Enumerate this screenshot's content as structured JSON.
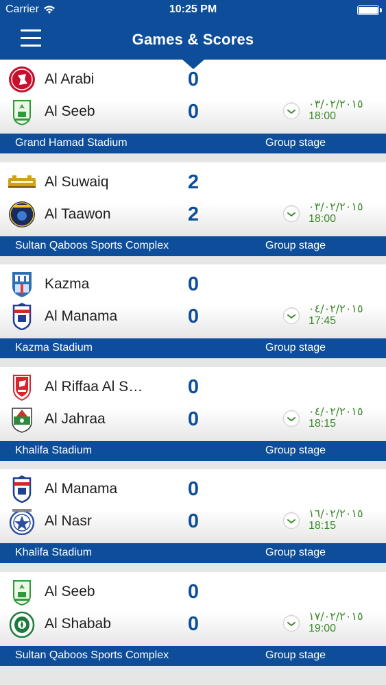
{
  "status": {
    "carrier": "Carrier",
    "time": "10:25 PM"
  },
  "nav": {
    "title": "Games & Scores"
  },
  "matches": [
    {
      "home": {
        "name": "Al Arabi",
        "score": "0",
        "logo": "al-arabi-logo",
        "color": "#c8102e"
      },
      "away": {
        "name": "Al Seeb",
        "score": "0",
        "logo": "al-seeb-logo",
        "color": "#2e9a3c"
      },
      "date": "٠٣/٠٢/٢٠١٥",
      "time": "18:00",
      "stadium": "Grand Hamad Stadium",
      "stage": "Group stage"
    },
    {
      "home": {
        "name": "Al Suwaiq",
        "score": "2",
        "logo": "al-suwaiq-logo",
        "color": "#d4a017"
      },
      "away": {
        "name": "Al Taawon",
        "score": "2",
        "logo": "al-taawon-logo",
        "color": "#1a2a5a"
      },
      "date": "٠٣/٠٢/٢٠١٥",
      "time": "18:00",
      "stadium": "Sultan Qaboos Sports Complex",
      "stage": "Group stage"
    },
    {
      "home": {
        "name": "Kazma",
        "score": "0",
        "logo": "kazma-logo",
        "color": "#2f6fb5"
      },
      "away": {
        "name": "Al Manama",
        "score": "0",
        "logo": "al-manama-logo",
        "color": "#1f3f8f"
      },
      "date": "٠٤/٠٢/٢٠١٥",
      "time": "17:45",
      "stadium": "Kazma Stadium",
      "stage": "Group stage"
    },
    {
      "home": {
        "name": "Al Riffaa Al Shamali",
        "score": "0",
        "logo": "al-riffaa-logo",
        "color": "#d7262b"
      },
      "away": {
        "name": "Al Jahraa",
        "score": "0",
        "logo": "al-jahraa-logo",
        "color": "#c0392b"
      },
      "date": "٠٤/٠٢/٢٠١٥",
      "time": "18:15",
      "stadium": "Khalifa Stadium",
      "stage": "Group stage"
    },
    {
      "home": {
        "name": "Al Manama",
        "score": "0",
        "logo": "al-manama-logo",
        "color": "#1f3f8f"
      },
      "away": {
        "name": "Al Nasr",
        "score": "0",
        "logo": "al-nasr-logo",
        "color": "#2c4f9e"
      },
      "date": "١٦/٠٢/٢٠١٥",
      "time": "18:15",
      "stadium": "Khalifa Stadium",
      "stage": "Group stage"
    },
    {
      "home": {
        "name": "Al Seeb",
        "score": "0",
        "logo": "al-seeb-logo",
        "color": "#2e9a3c"
      },
      "away": {
        "name": "Al Shabab",
        "score": "0",
        "logo": "al-shabab-logo",
        "color": "#1e7a3a"
      },
      "date": "١٧/٠٢/٢٠١٥",
      "time": "19:00",
      "stadium": "Sultan Qaboos Sports Complex",
      "stage": "Group stage"
    }
  ],
  "colors": {
    "brand": "#0d4d9a",
    "score": "#0d4d9a",
    "datetime": "#3a8a2a"
  }
}
